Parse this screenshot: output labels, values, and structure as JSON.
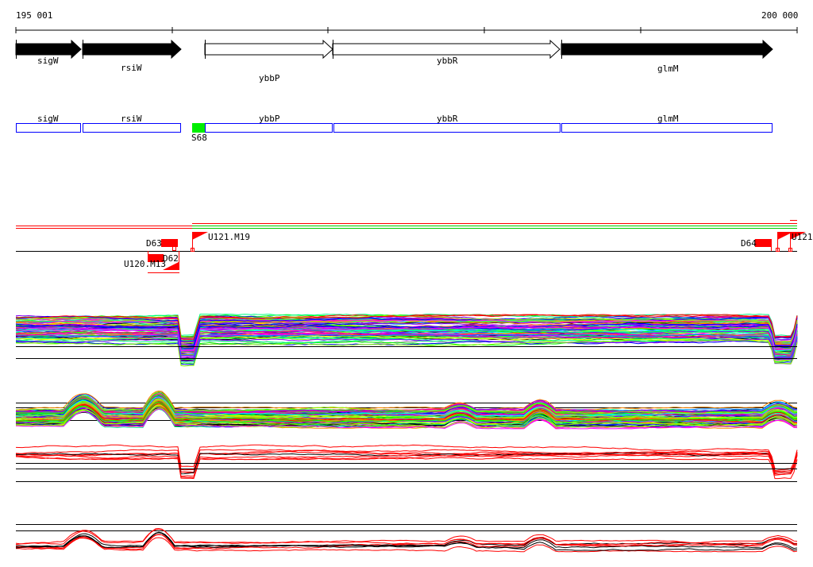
{
  "ruler": {
    "start_label": "195 001",
    "end_label": "200 000"
  },
  "genes": [
    {
      "name": "sigW",
      "strand": "+",
      "fill": "#000000"
    },
    {
      "name": "rsiW",
      "strand": "+",
      "fill": "#000000"
    },
    {
      "name": "ybbP",
      "strand": "+",
      "fill": "#ffffff"
    },
    {
      "name": "ybbR",
      "strand": "+",
      "fill": "#ffffff"
    },
    {
      "name": "glmM",
      "strand": "+",
      "fill": "#000000"
    }
  ],
  "annotation_boxes": [
    "sigW",
    "rsiW",
    "ybbP",
    "ybbR",
    "glmM"
  ],
  "site_marker": {
    "label": "S68",
    "color": "#00ee00"
  },
  "features": [
    {
      "label": "D63"
    },
    {
      "label": "D62"
    },
    {
      "label": "U120.M13"
    },
    {
      "label": "U121.M19"
    },
    {
      "label": "D64"
    },
    {
      "label": "U121"
    }
  ],
  "colors": {
    "box_border": "#0000ff",
    "feature": "#ff0000",
    "line_green": "#00cc00"
  }
}
